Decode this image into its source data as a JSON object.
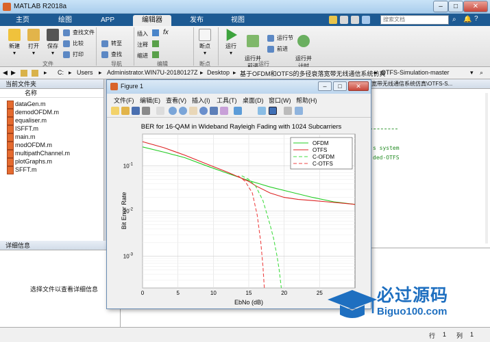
{
  "app": {
    "title": "MATLAB R2018a",
    "window_buttons": [
      "–",
      "□",
      "✕"
    ]
  },
  "tabs": [
    "主页",
    "绘图",
    "APP",
    "编辑器",
    "发布",
    "视图"
  ],
  "active_tab": "编辑器",
  "search": {
    "placeholder": "搜索文档"
  },
  "ribbon": {
    "file": {
      "new": "新建",
      "open": "打开",
      "save": "保存",
      "find_files": "查找文件",
      "compare": "比较",
      "print": "打印",
      "group": "文件"
    },
    "navigate": {
      "goto": "转至",
      "find": "查找",
      "group": "导航"
    },
    "edit": {
      "insert": "插入",
      "comment": "注释",
      "indent": "缩进",
      "fx": "fx",
      "group": "编辑"
    },
    "breakpoints": {
      "label": "断点",
      "group": "断点"
    },
    "run": {
      "run": "运行",
      "run_advance": "运行并\n前进",
      "run_section": "运行节",
      "advance": "前进",
      "run_time": "运行并\n计时",
      "group": "运行"
    }
  },
  "address": {
    "segments": [
      "C:",
      "Users",
      "Administrator.WIN7U-20180127Z",
      "Desktop",
      "基于OFDM和OTFS的多径衰落宽带无线通信系统仿真",
      "OTFS-Simulation-master"
    ]
  },
  "files_panel": {
    "title": "当前文件夹",
    "column": "名称",
    "items": [
      "dataGen.m",
      "demodOFDM.m",
      "equaliser.m",
      "ISFFT.m",
      "main.m",
      "modOFDM.m",
      "multipathChannel.m",
      "plotGraphs.m",
      "SFFT.m"
    ]
  },
  "details_panel": {
    "title": "详细信息",
    "message": "选择文件以查看详细信息"
  },
  "editor_peek": {
    "path": "宽带无线通信系统仿真\\OTFS-S...",
    "lines": [
      "s system",
      "ded-OTFS"
    ]
  },
  "status": {
    "row_label": "行",
    "row": "1",
    "col_label": "列",
    "col": "1"
  },
  "figure": {
    "title": "Figure 1",
    "menu": [
      "文件(F)",
      "编辑(E)",
      "查看(V)",
      "插入(I)",
      "工具(T)",
      "桌面(D)",
      "窗口(W)",
      "帮助(H)"
    ]
  },
  "chart_data": {
    "type": "line",
    "title": "BER for 16-QAM in Wideband Rayleigh Fading with 1024 Subcarriers",
    "xlabel": "EbNo (dB)",
    "ylabel": "Bit Error Rate",
    "xlim": [
      0,
      30
    ],
    "ylim": [
      0.0002,
      0.5
    ],
    "yscale": "log",
    "xticks": [
      0,
      5,
      10,
      15,
      20,
      25
    ],
    "yticks": [
      0.001,
      0.01,
      0.1
    ],
    "ytick_labels": [
      "10^-3",
      "10^-2",
      "10^-1"
    ],
    "grid": true,
    "legend_position": "top-right",
    "series": [
      {
        "name": "OFDM",
        "color": "#22cc22",
        "dash": false,
        "x": [
          0,
          3,
          6,
          9,
          12,
          15,
          18,
          21,
          24,
          27,
          30
        ],
        "y": [
          0.26,
          0.2,
          0.15,
          0.1,
          0.068,
          0.047,
          0.034,
          0.026,
          0.02,
          0.016,
          0.014
        ]
      },
      {
        "name": "OTFS",
        "color": "#dd2222",
        "dash": false,
        "x": [
          0,
          3,
          6,
          9,
          12,
          15,
          16,
          18,
          20,
          22,
          24,
          26,
          28,
          30
        ],
        "y": [
          0.34,
          0.25,
          0.17,
          0.11,
          0.072,
          0.045,
          0.036,
          0.025,
          0.02,
          0.018,
          0.017,
          0.016,
          0.015,
          0.014
        ]
      },
      {
        "name": "C-OFDM",
        "color": "#44dd44",
        "dash": true,
        "x": [
          14,
          15,
          16,
          17,
          18,
          18.5,
          19,
          19.3,
          19.6
        ],
        "y": [
          0.06,
          0.05,
          0.035,
          0.017,
          0.005,
          0.0025,
          0.001,
          0.0005,
          0.0002
        ]
      },
      {
        "name": "C-OTFS",
        "color": "#ee4444",
        "dash": true,
        "x": [
          13.5,
          14.5,
          15.5,
          16.2,
          16.7,
          17,
          17.2
        ],
        "y": [
          0.06,
          0.045,
          0.025,
          0.008,
          0.002,
          0.0006,
          0.0002
        ]
      }
    ]
  },
  "logo": {
    "text": "必过源码",
    "url_text": "Biguo100.com"
  }
}
